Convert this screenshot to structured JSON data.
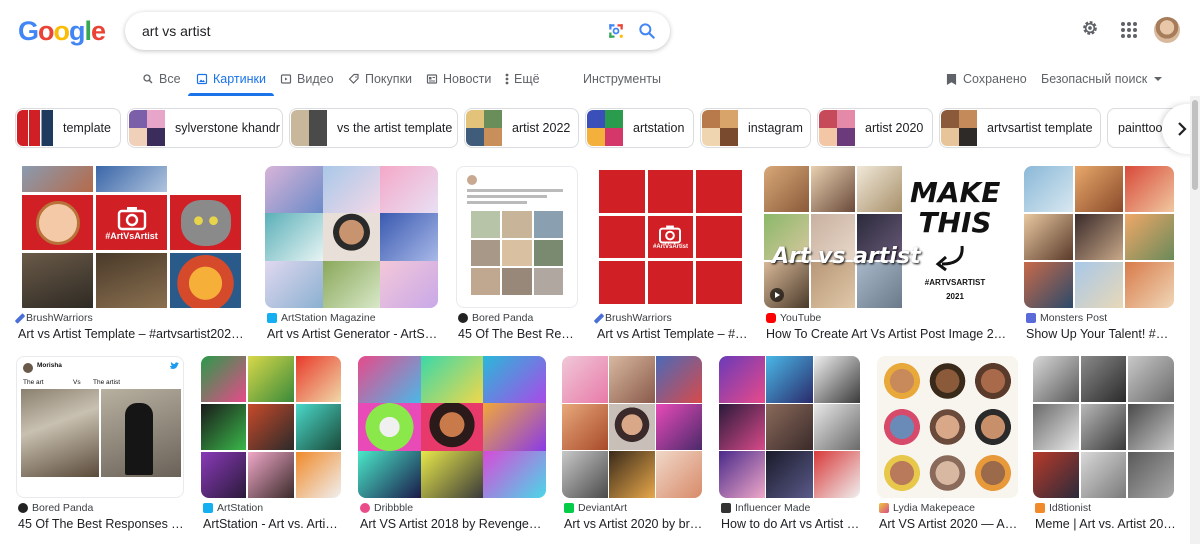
{
  "search": {
    "query": "art vs artist"
  },
  "tabs": [
    {
      "label": "Все"
    },
    {
      "label": "Картинки"
    },
    {
      "label": "Видео"
    },
    {
      "label": "Покупки"
    },
    {
      "label": "Новости"
    },
    {
      "label": "Ещё"
    },
    {
      "label": "Инструменты"
    }
  ],
  "right_tools": {
    "saved": "Сохранено",
    "safe_search": "Безопасный поиск"
  },
  "chips": [
    {
      "label": "template"
    },
    {
      "label": "sylverstone khandr"
    },
    {
      "label": "vs the artist template"
    },
    {
      "label": "artist 2022"
    },
    {
      "label": "artstation"
    },
    {
      "label": "instagram"
    },
    {
      "label": "artist 2020"
    },
    {
      "label": "artvsartist template"
    },
    {
      "label": "painttoo"
    }
  ],
  "row1": [
    {
      "source": "BrushWarriors",
      "title": "Art vs Artist Template – #artvsartist2022 –..."
    },
    {
      "source": "ArtStation Magazine",
      "title": "Art vs Artist Generator - ArtStati..."
    },
    {
      "source": "Bored Panda",
      "title": "45 Of The Best Resp..."
    },
    {
      "source": "BrushWarriors",
      "title": "Art vs Artist Template – #ar..."
    },
    {
      "source": "YouTube",
      "title": "How To Create Art Vs Artist Post Image 2021 ..."
    },
    {
      "source": "Monsters Post",
      "title": "Show Up Your Talent! #Art..."
    }
  ],
  "row2": [
    {
      "source": "Bored Panda",
      "title": "45 Of The Best Responses To ..."
    },
    {
      "source": "ArtStation",
      "title": "ArtStation - Art vs. Artist ..."
    },
    {
      "source": "Dribbble",
      "title": "Art VS Artist 2018 by RevengeLove..."
    },
    {
      "source": "DeviantArt",
      "title": "Art vs Artist 2020 by bria..."
    },
    {
      "source": "Influencer Made",
      "title": "How to do Art vs Artist o..."
    },
    {
      "source": "Lydia Makepeace",
      "title": "Art VS Artist 2020 — Arti..."
    },
    {
      "source": "Id8tionist",
      "title": "Meme | Art vs. Artist 202..."
    }
  ],
  "thumb_text": {
    "hashtag": "#ArtVsArtist",
    "make": "MAKE",
    "this": "THIS",
    "art_vs_artist": "Art vs artist",
    "artvsartist": "#ARTVSARTIST",
    "year": "2021",
    "tweet_name": "Morisha",
    "the_art": "The art",
    "vs": "Vs",
    "the_artist": "The artist"
  },
  "colors": {
    "google_blue": "#4285F4",
    "google_red": "#EA4335",
    "google_yellow": "#FBBC05",
    "google_green": "#34A853",
    "accent": "#1a73e8",
    "template_red": "#d11f26"
  }
}
